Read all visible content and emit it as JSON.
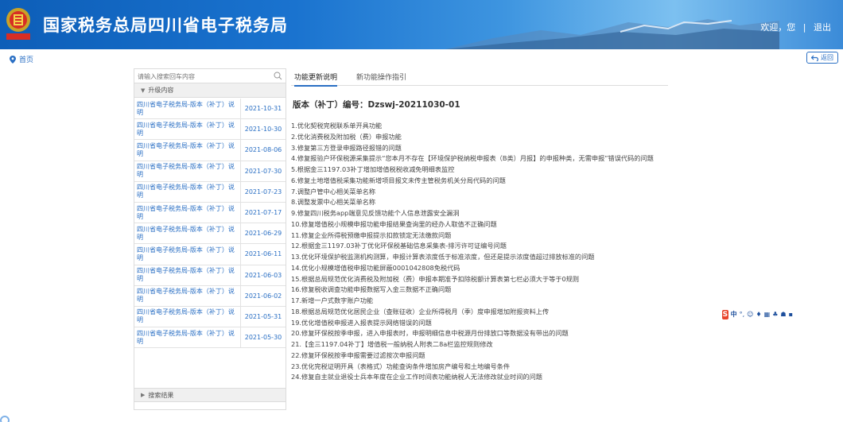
{
  "header": {
    "title": "国家税务总局四川省电子税务局",
    "welcome": "欢迎，您",
    "separator": "|",
    "logout": "退出"
  },
  "breadcrumb": {
    "home": "首页"
  },
  "back_label": "返回",
  "sidebar": {
    "search_placeholder": "请输入搜索回车内容",
    "group_upgrade": "升级内容",
    "group_results": "搜索结果",
    "items": [
      {
        "title": "四川省电子税务局-版本（补丁）说明",
        "date": "2021-10-31"
      },
      {
        "title": "四川省电子税务局-版本（补丁）说明",
        "date": "2021-10-30"
      },
      {
        "title": "四川省电子税务局-版本（补丁）说明",
        "date": "2021-08-06"
      },
      {
        "title": "四川省电子税务局-版本（补丁）说明",
        "date": "2021-07-30"
      },
      {
        "title": "四川省电子税务局-版本（补丁）说明",
        "date": "2021-07-23"
      },
      {
        "title": "四川省电子税务局-版本（补丁）说明",
        "date": "2021-07-17"
      },
      {
        "title": "四川省电子税务局-版本（补丁）说明",
        "date": "2021-06-29"
      },
      {
        "title": "四川省电子税务局-版本（补丁）说明",
        "date": "2021-06-11"
      },
      {
        "title": "四川省电子税务局-版本（补丁）说明",
        "date": "2021-06-03"
      },
      {
        "title": "四川省电子税务局-版本（补丁）说明",
        "date": "2021-06-02"
      },
      {
        "title": "四川省电子税务局-版本（补丁）说明",
        "date": "2021-05-31"
      },
      {
        "title": "四川省电子税务局-版本（补丁）说明",
        "date": "2021-05-30"
      }
    ]
  },
  "tabs": [
    {
      "label": "功能更新说明",
      "active": true
    },
    {
      "label": "新功能操作指引",
      "active": false
    }
  ],
  "content": {
    "version": "版本（补丁）编号：Dzswj-20211030-01",
    "items": [
      "1.优化契税完税联系单开具功能",
      "2.优化消费税及附加税（费）申报功能",
      "3.修复第三方登录申报路径报错的问题",
      "4.修复报验户环保税源采集提示“您本月不存在【环境保护税纳税申报表（B类）月报】的申报种类，无需申报”错误代码的问题",
      "5.根据金三1197.03补丁增加增值税税收减免明细表监控",
      "6.修复土地增值税采集功能新增项目报文未传主管税务机关分局代码的问题",
      "7.调整户管中心相关菜单名称",
      "8.调整发票中心相关菜单名称",
      "9.修复四川税务app端意见反馈功能个人信息泄露安全漏洞",
      "10.修复增值税小规模申报功能申报结果查询里的经办人取值不正确问题",
      "11.修复企业所得税预缴申报提示扣款锁定无法缴款问题",
      "12.根据金三1197.03补丁优化环保税基础信息采集表-排污许可证编号问题",
      "13.优化环境保护税监测机构测算，申报计算表浓度低于标准浓度，但还是提示浓度值超过排放标准的问题",
      "14.优化小规模增值税申报功能屏蔽0001042808免税代码",
      "15.根据总局规范优化消费税及附加税（费）申报本期准予扣除税额计算表第七栏必须大于等于0规则",
      "16.修复税收调查功能申报数据写入金三数据不正确问题",
      "17.新增一户式数字账户功能",
      "18.根据总局规范优化居民企业（查账征收）企业所得税月（季）度申报增加附报资料上传",
      "19.优化增值税申报进入报表提示网络错误的问题",
      "20.修复环保税按季申报，进入申报表时，申报明细信息中税源月份排放口等数据没有带出的问题",
      "21.【金三1197.04补丁】增值税一般纳税人附表二8a栏监控规则修改",
      "22.修复环保税按季申报需要过滤按次申报问题",
      "23.优化完税证明开具（表格式）功能查询条件增加房产编号和土地编号条件",
      "24.修复自主就业退役士兵本年度在企业工作时间表功能纳税人无法修改就业时间的问题"
    ]
  },
  "ime": {
    "logo": "S",
    "lang": "中",
    "punct": "°,",
    "glyphs": [
      "☺",
      "♦",
      "▦",
      "♣",
      "☗",
      "▪"
    ]
  },
  "colors": {
    "header_blue": "#1a73cf",
    "link_blue": "#2a6fc4",
    "ime_red": "#e8452c"
  }
}
